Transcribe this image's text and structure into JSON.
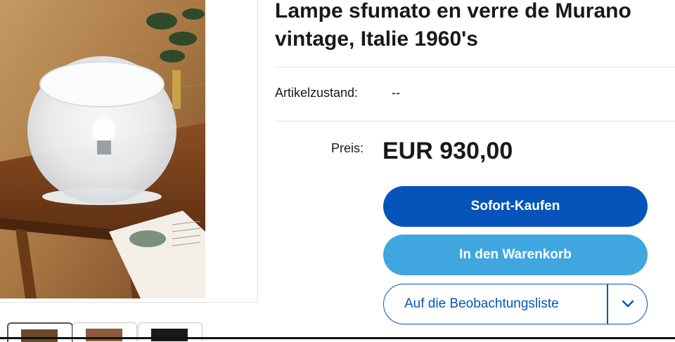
{
  "listing": {
    "title": "Lampe sfumato en verre de Murano vintage, Italie 1960's",
    "condition_label": "Artikelzustand:",
    "condition_value": "--",
    "price_label": "Preis:",
    "price_value": "EUR 930,00"
  },
  "actions": {
    "buy_now": "Sofort-Kaufen",
    "add_to_cart": "In den Warenkorb",
    "watchlist": "Auf die Beobachtungsliste"
  },
  "icons": {
    "watchlist_dropdown": "chevron-down-icon"
  },
  "colors": {
    "primary_blue": "#0654ba",
    "secondary_blue": "#3fa6df"
  }
}
